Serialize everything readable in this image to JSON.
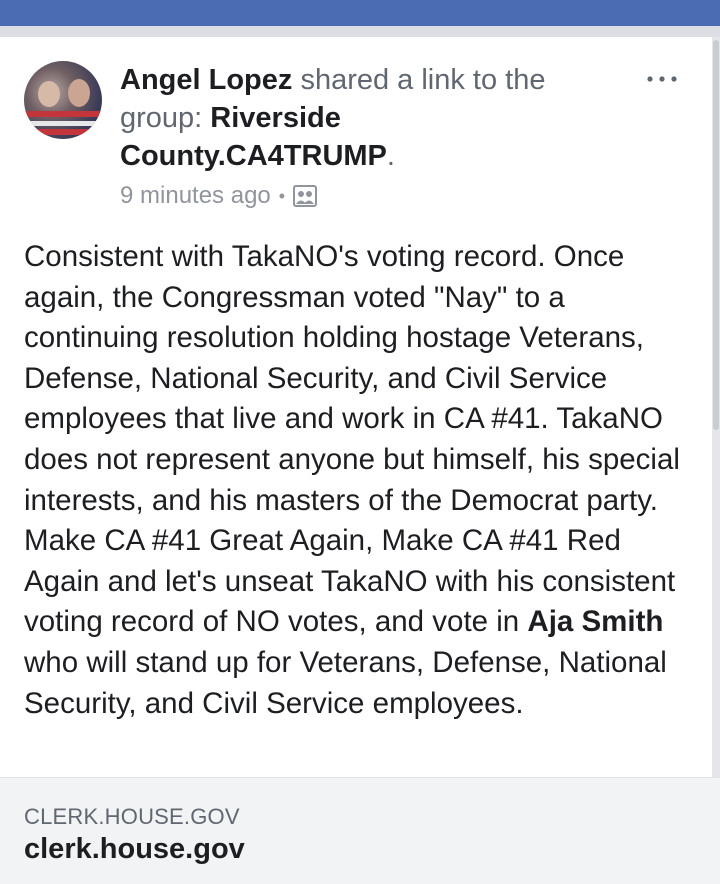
{
  "post": {
    "author": "Angel Lopez",
    "action": " shared a link to the group: ",
    "group": "Riverside County.CA4TRUMP",
    "group_suffix": ".",
    "timestamp": "9 minutes ago",
    "separator": "•",
    "privacy_icon": "group-icon",
    "more_icon": "more-options-icon",
    "body": {
      "text_before": "Consistent with TakaNO's voting record. Once again, the Congressman voted \"Nay\" to a continuing resolution holding hostage Veterans, Defense, National Security, and Civil Service employees that live and work in CA #41. TakaNO does not represent anyone but himself, his special interests, and his masters of the Democrat party. Make CA #41 Great Again, Make CA #41 Red Again and let's unseat TakaNO with his consistent voting record of NO votes, and vote in ",
      "mention": "Aja Smith",
      "text_after": " who will stand up for Veterans, Defense, National Security, and Civil Service employees."
    }
  },
  "link_card": {
    "domain": "CLERK.HOUSE.GOV",
    "title": "clerk.house.gov"
  },
  "colors": {
    "top_bar": "#4a6cb3",
    "primary_text": "#1c1e21",
    "secondary_text": "#606770",
    "meta_text": "#90949c",
    "card_bg": "#f2f3f5"
  }
}
